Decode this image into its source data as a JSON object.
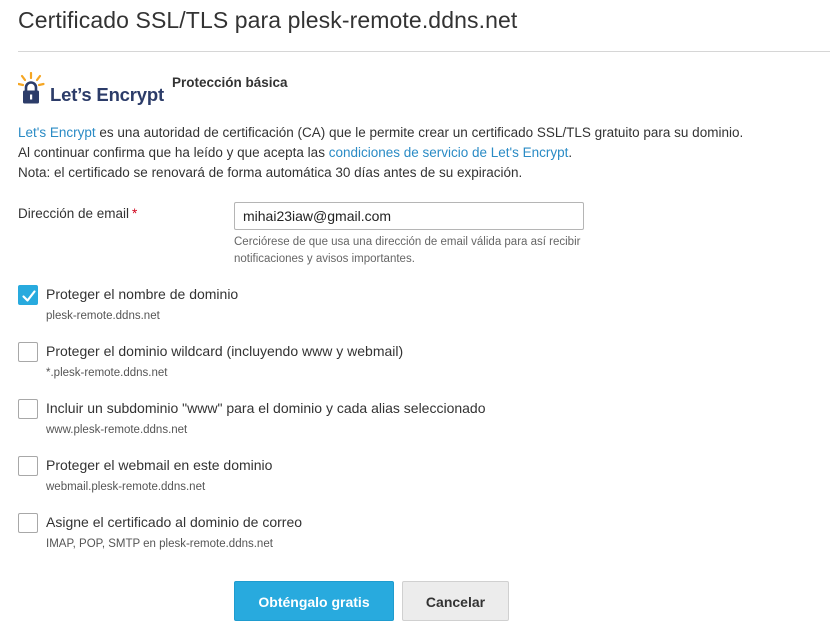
{
  "page": {
    "title": "Certificado SSL/TLS para plesk-remote.ddns.net"
  },
  "provider": {
    "logo_text": "Let’s Encrypt",
    "plan_label": "Protección básica"
  },
  "description": {
    "link_letsencrypt": "Let's Encrypt",
    "line1_rest": " es una autoridad de certificación (CA) que le permite crear un certificado SSL/TLS gratuito para su dominio.",
    "line2_prefix": "Al continuar confirma que ha leído y que acepta las ",
    "link_terms": "condiciones de servicio de Let's Encrypt",
    "line2_suffix": ".",
    "line3": "Nota: el certificado se renovará de forma automática 30 días antes de su expiración."
  },
  "email": {
    "label": "Dirección de email",
    "required_mark": "*",
    "value": "mihai23iaw@gmail.com",
    "hint_line1": "Cerciórese de que usa una dirección de email válida para así recibir",
    "hint_line2": "notificaciones y avisos importantes."
  },
  "options": [
    {
      "label": "Proteger el nombre de dominio",
      "sub": "plesk-remote.ddns.net",
      "checked": true
    },
    {
      "label": "Proteger el dominio wildcard (incluyendo www y webmail)",
      "sub": "*.plesk-remote.ddns.net",
      "checked": false
    },
    {
      "label": "Incluir un subdominio \"www\" para el dominio y cada alias seleccionado",
      "sub": "www.plesk-remote.ddns.net",
      "checked": false
    },
    {
      "label": "Proteger el webmail en este dominio",
      "sub": "webmail.plesk-remote.ddns.net",
      "checked": false
    },
    {
      "label": "Asigne el certificado al dominio de correo",
      "sub": "IMAP, POP, SMTP en plesk-remote.ddns.net",
      "checked": false
    }
  ],
  "buttons": {
    "primary": "Obténgalo gratis",
    "secondary": "Cancelar"
  },
  "colors": {
    "accent": "#28aade",
    "link": "#2a8bc5",
    "logo_navy": "#2c3c69",
    "logo_sun": "#f5a623",
    "required": "#d0021b"
  },
  "icons": {
    "logo": "lets-encrypt-padlock-sun-icon",
    "checkmark": "checkmark-icon"
  }
}
